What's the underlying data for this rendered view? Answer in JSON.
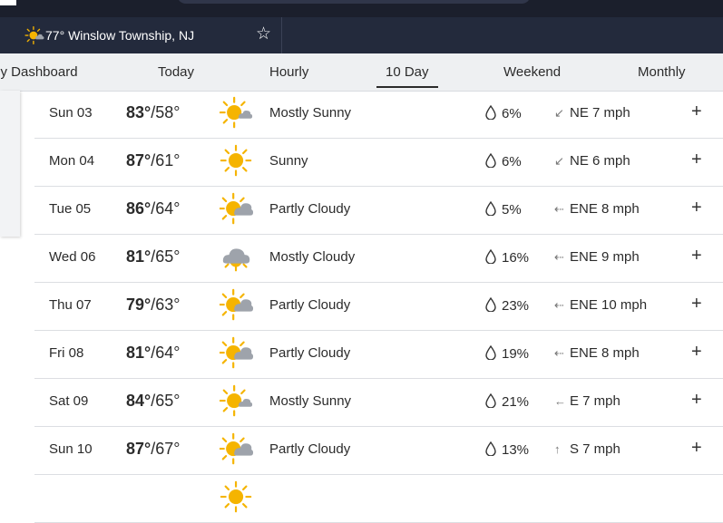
{
  "location": {
    "temp": "77°",
    "name": "Winslow Township, NJ"
  },
  "nav": {
    "tabs": [
      "My Dashboard",
      "Today",
      "Hourly",
      "10 Day",
      "Weekend",
      "Monthly"
    ],
    "active": "10 Day"
  },
  "colors": {
    "sun": "#f5b400",
    "cloud": "#9ea3ab",
    "header_dark": "#232a3c"
  },
  "forecast": [
    {
      "day": "Sun 03",
      "hi": "83°",
      "lo": "58°",
      "icon": "mostly-sunny-icon",
      "cond": "Mostly Sunny",
      "precip": "6%",
      "wind_dir_icon": "arrow-from-ne",
      "wind": "NE 7 mph"
    },
    {
      "day": "Mon 04",
      "hi": "87°",
      "lo": "61°",
      "icon": "sunny-icon",
      "cond": "Sunny",
      "precip": "6%",
      "wind_dir_icon": "arrow-from-ne",
      "wind": "NE 6 mph"
    },
    {
      "day": "Tue 05",
      "hi": "86°",
      "lo": "64°",
      "icon": "partly-cloudy-icon",
      "cond": "Partly Cloudy",
      "precip": "5%",
      "wind_dir_icon": "arrow-from-ene",
      "wind": "ENE 8 mph"
    },
    {
      "day": "Wed 06",
      "hi": "81°",
      "lo": "65°",
      "icon": "mostly-cloudy-icon",
      "cond": "Mostly Cloudy",
      "precip": "16%",
      "wind_dir_icon": "arrow-from-ene",
      "wind": "ENE 9 mph"
    },
    {
      "day": "Thu 07",
      "hi": "79°",
      "lo": "63°",
      "icon": "partly-cloudy-icon",
      "cond": "Partly Cloudy",
      "precip": "23%",
      "wind_dir_icon": "arrow-from-ene",
      "wind": "ENE 10 mph"
    },
    {
      "day": "Fri 08",
      "hi": "81°",
      "lo": "64°",
      "icon": "partly-cloudy-icon",
      "cond": "Partly Cloudy",
      "precip": "19%",
      "wind_dir_icon": "arrow-from-ene",
      "wind": "ENE 8 mph"
    },
    {
      "day": "Sat 09",
      "hi": "84°",
      "lo": "65°",
      "icon": "mostly-sunny-icon",
      "cond": "Mostly Sunny",
      "precip": "21%",
      "wind_dir_icon": "arrow-from-e",
      "wind": "E 7 mph"
    },
    {
      "day": "Sun 10",
      "hi": "87°",
      "lo": "67°",
      "icon": "partly-cloudy-icon",
      "cond": "Partly Cloudy",
      "precip": "13%",
      "wind_dir_icon": "arrow-from-s",
      "wind": "S 7 mph"
    }
  ]
}
